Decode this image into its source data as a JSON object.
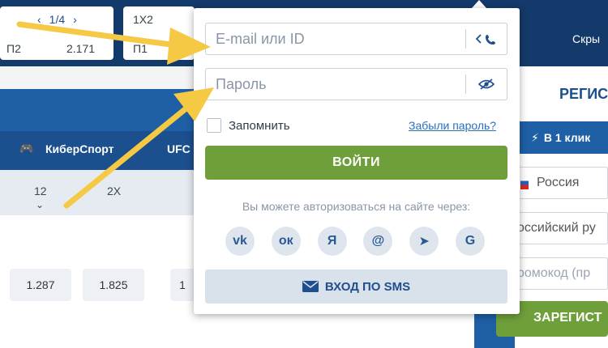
{
  "background": {
    "top_cards": [
      {
        "pager": "1/4",
        "label": "П2",
        "value": "2.171"
      },
      {
        "header": "1X2",
        "label": "П1",
        "value": ""
      }
    ],
    "nav2": {
      "esports_label": "КиберСпорт",
      "ufc_label": "UFC"
    },
    "subrow": {
      "col1": "12",
      "col2": "2X"
    },
    "odds": [
      "1.287",
      "1.825",
      "1"
    ]
  },
  "right_panel": {
    "hide_label": "Скры",
    "title": "РЕГИС",
    "one_click_tab": "В 1 клик",
    "country": "Россия",
    "currency": "оссийский ру",
    "promo_placeholder": "ромокод (пр",
    "register_button": "ЗАРЕГИСТ"
  },
  "login": {
    "email_placeholder": "E-mail или ID",
    "password_placeholder": "Пароль",
    "remember_label": "Запомнить",
    "forgot_link": "Забыли пароль?",
    "login_button": "ВОЙТИ",
    "via_text": "Вы можете авторизоваться на сайте через:",
    "social": [
      {
        "name": "vk",
        "glyph": "vk"
      },
      {
        "name": "odnoklassniki",
        "glyph": "ок"
      },
      {
        "name": "yandex",
        "glyph": "Я"
      },
      {
        "name": "mail",
        "glyph": "@"
      },
      {
        "name": "telegram",
        "glyph": "➤"
      },
      {
        "name": "google",
        "glyph": "G"
      }
    ],
    "sms_button": "ВХОД ПО SMS"
  },
  "colors": {
    "primary_dark": "#133a6b",
    "primary": "#1f5fa6",
    "accent_green": "#6f9f3a",
    "arrow_yellow": "#f6c945"
  }
}
